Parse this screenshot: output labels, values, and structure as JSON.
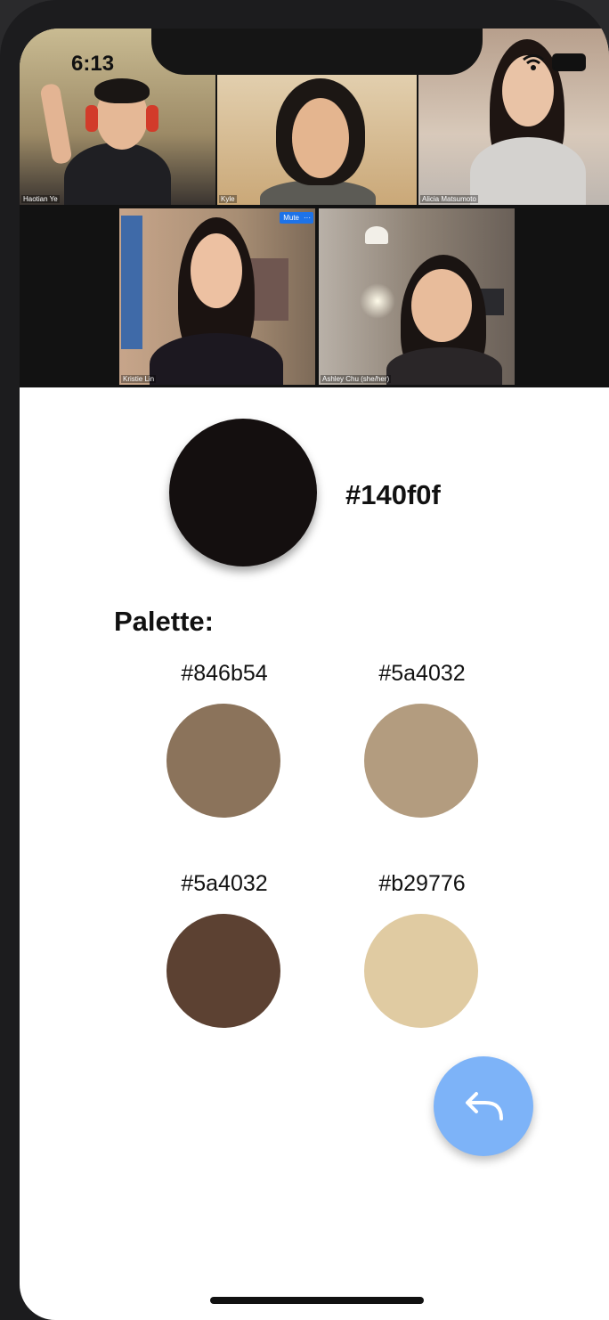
{
  "status_bar": {
    "time": "6:13"
  },
  "participants": [
    {
      "name": "Haotian Ye"
    },
    {
      "name": "Kyle"
    },
    {
      "name": "Alicia Matsumoto"
    },
    {
      "name": "Kristie Lin"
    },
    {
      "name": "Ashley Chu (she/her)"
    }
  ],
  "video_controls": {
    "mute_label": "Mute",
    "more_label": "···"
  },
  "main_color": {
    "hex": "#140f0f",
    "swatch_color": "#140f0f"
  },
  "palette": {
    "title": "Palette:",
    "swatches": [
      {
        "label": "#846b54",
        "color": "#8b735b"
      },
      {
        "label": "#5a4032",
        "color": "#b39c7f"
      },
      {
        "label": "#5a4032",
        "color": "#5c4132"
      },
      {
        "label": "#b29776",
        "color": "#e0cba2"
      }
    ]
  },
  "back_button": {
    "icon": "reply-arrow-icon",
    "color": "#7db3f8"
  }
}
